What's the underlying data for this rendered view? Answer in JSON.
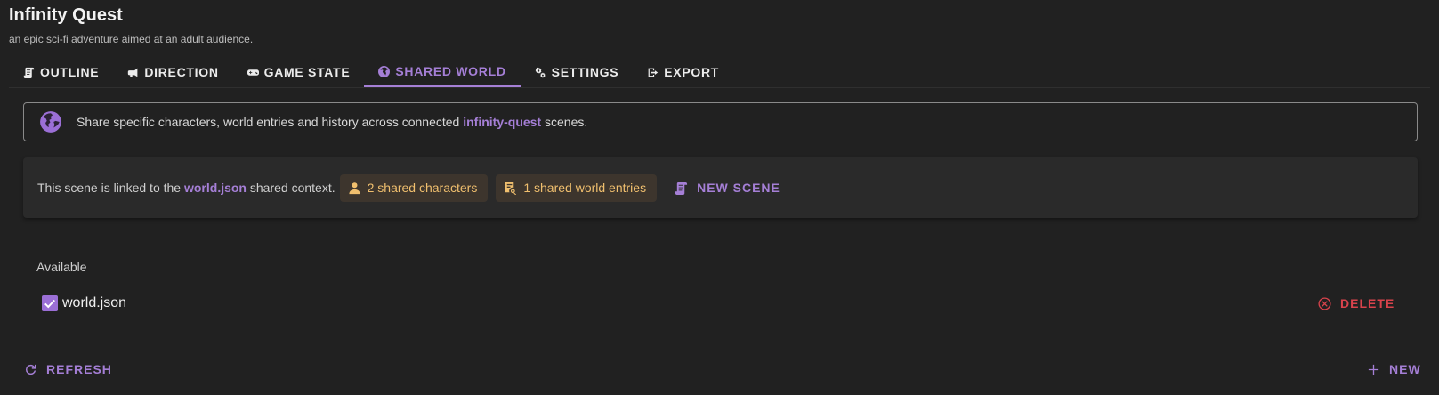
{
  "header": {
    "title": "Infinity Quest",
    "subtitle": "an epic sci-fi adventure aimed at an adult audience."
  },
  "tabs": [
    {
      "label": "OUTLINE",
      "icon": "scroll-icon",
      "active": false
    },
    {
      "label": "DIRECTION",
      "icon": "bullhorn-icon",
      "active": false
    },
    {
      "label": "GAME STATE",
      "icon": "gamepad-icon",
      "active": false
    },
    {
      "label": "SHARED WORLD",
      "icon": "globe-icon",
      "active": true
    },
    {
      "label": "SETTINGS",
      "icon": "cogs-icon",
      "active": false
    },
    {
      "label": "EXPORT",
      "icon": "export-icon",
      "active": false
    }
  ],
  "info": {
    "text_before": "Share specific characters, world entries and history across connected ",
    "highlight": "infinity-quest",
    "text_after": " scenes."
  },
  "link": {
    "text_before": "This scene is linked to the ",
    "file": "world.json",
    "text_after": " shared context.",
    "chip_characters": "2 shared characters",
    "chip_entries": "1 shared world entries",
    "new_scene_label": "NEW SCENE"
  },
  "available": {
    "label": "Available",
    "items": [
      {
        "name": "world.json",
        "checked": true
      }
    ],
    "delete_label": "DELETE"
  },
  "footer": {
    "refresh_label": "REFRESH",
    "new_label": "NEW"
  },
  "colors": {
    "accent": "#a57fd6",
    "chip_text": "#f0bf6e",
    "danger": "#d9434c",
    "background": "#212121"
  }
}
